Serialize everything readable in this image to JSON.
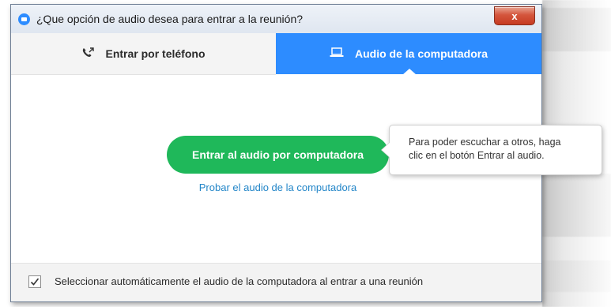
{
  "window": {
    "title": "¿Que opción de audio desea para entrar a la reunión?",
    "close_label": "x"
  },
  "tabs": [
    {
      "label": "Entrar por teléfono",
      "icon": "phone-icon",
      "active": false
    },
    {
      "label": "Audio de la computadora",
      "icon": "laptop-icon",
      "active": true
    }
  ],
  "main": {
    "join_button_label": "Entrar al audio por computadora",
    "test_link_label": "Probar el audio de la computadora"
  },
  "tooltip": {
    "line1": "Para poder escuchar a otros, haga",
    "line2": "clic en el botón Entrar al audio."
  },
  "footer": {
    "auto_select_label": "Seleccionar automáticamente el audio de la computadora al entrar a una reunión",
    "auto_select_checked": true
  },
  "colors": {
    "accent": "#2d8cff",
    "join_green": "#1fb85a",
    "link_blue": "#2386c8",
    "close_red": "#c63b22"
  }
}
